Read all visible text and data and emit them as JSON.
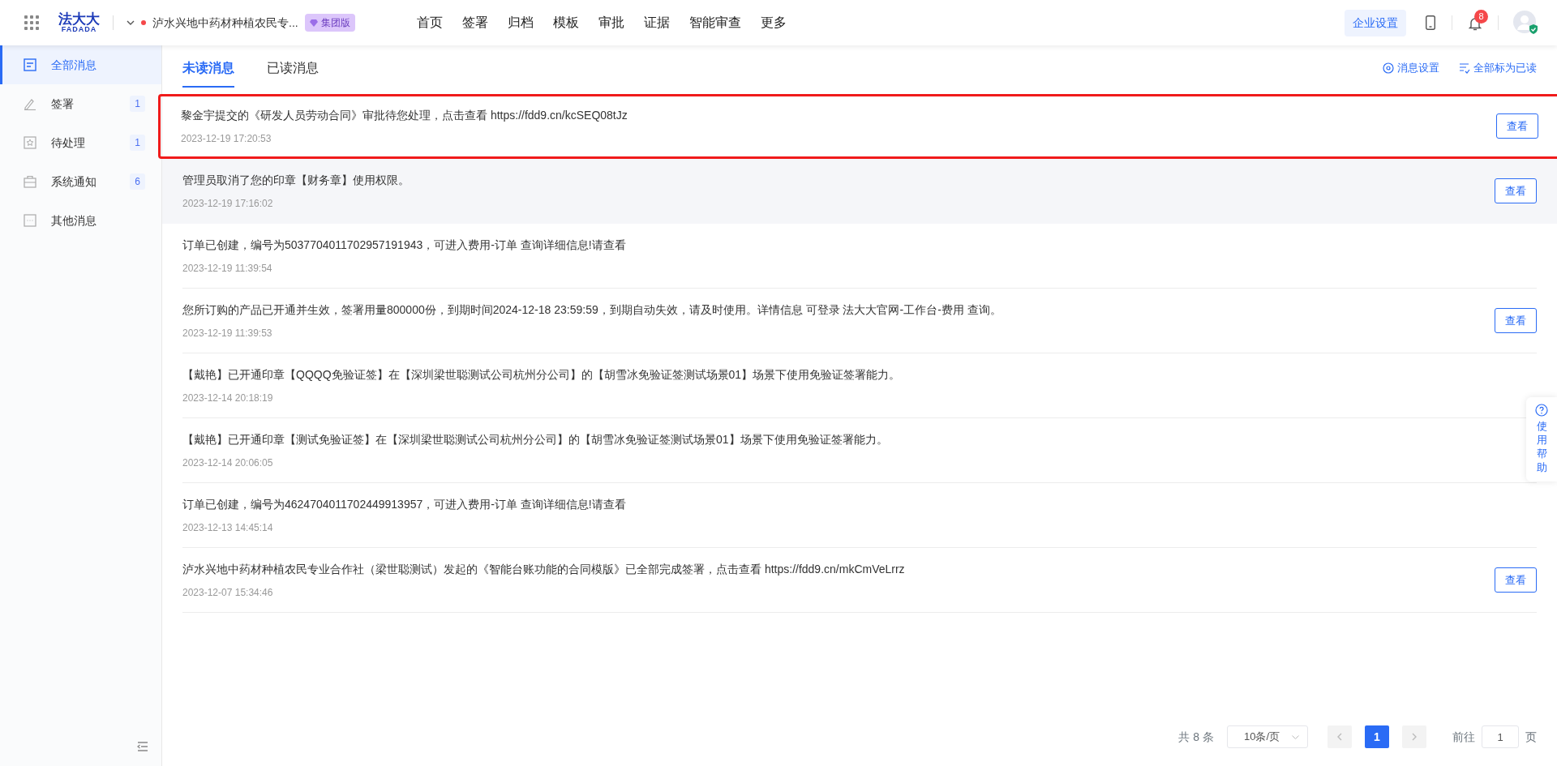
{
  "header": {
    "logo": {
      "cn": "法大大",
      "en": "FADADA"
    },
    "company": "泸水兴地中药材种植农民专...",
    "edition": "集团版",
    "nav": [
      {
        "label": "首页"
      },
      {
        "label": "签署"
      },
      {
        "label": "归档"
      },
      {
        "label": "模板"
      },
      {
        "label": "审批"
      },
      {
        "label": "证据"
      },
      {
        "label": "智能审查"
      },
      {
        "label": "更多"
      }
    ],
    "settings_button": "企业设置",
    "notification_count": "8"
  },
  "sidebar": {
    "items": [
      {
        "label": "全部消息",
        "selected": true
      },
      {
        "label": "签署",
        "count": "1",
        "selected": false
      },
      {
        "label": "待处理",
        "count": "1",
        "selected": false
      },
      {
        "label": "系统通知",
        "count": "6",
        "selected": false
      },
      {
        "label": "其他消息",
        "selected": false
      }
    ]
  },
  "tabs": [
    {
      "label": "未读消息",
      "selected": true
    },
    {
      "label": "已读消息",
      "selected": false
    }
  ],
  "actions": [
    "消息设置",
    "全部标为已读"
  ],
  "messages": [
    {
      "text": "黎金宇提交的《研发人员劳动合同》审批待您处理，点击查看 https://fdd9.cn/kcSEQ08tJz",
      "time": "2023-12-19 17:20:53",
      "action": "查看",
      "annotated": true,
      "hovered": false
    },
    {
      "text": "管理员取消了您的印章【财务章】使用权限。",
      "time": "2023-12-19 17:16:02",
      "action": "查看",
      "annotated": false,
      "hovered": true
    },
    {
      "text": "订单已创建，编号为5037704011702957191943，可进入费用-订单 查询详细信息!请查看",
      "time": "2023-12-19 11:39:54",
      "annotated": false,
      "hovered": false
    },
    {
      "text": "您所订购的产品已开通并生效，签署用量800000份，到期时间2024-12-18 23:59:59，到期自动失效，请及时使用。详情信息 可登录 法大大官网-工作台-费用 查询。",
      "time": "2023-12-19 11:39:53",
      "action": "查看",
      "annotated": false,
      "hovered": false
    },
    {
      "text": "【戴艳】已开通印章【QQQQ免验证签】在【深圳梁世聪测试公司杭州分公司】的【胡雪冰免验证签测试场景01】场景下使用免验证签署能力。",
      "time": "2023-12-14 20:18:19",
      "annotated": false,
      "hovered": false
    },
    {
      "text": "【戴艳】已开通印章【测试免验证签】在【深圳梁世聪测试公司杭州分公司】的【胡雪冰免验证签测试场景01】场景下使用免验证签署能力。",
      "time": "2023-12-14 20:06:05",
      "annotated": false,
      "hovered": false
    },
    {
      "text": "订单已创建，编号为4624704011702449913957，可进入费用-订单 查询详细信息!请查看",
      "time": "2023-12-13 14:45:14",
      "annotated": false,
      "hovered": false
    },
    {
      "text": "泸水兴地中药材种植农民专业合作社（梁世聪测试）发起的《智能台账功能的合同模版》已全部完成签署，点击查看 https://fdd9.cn/mkCmVeLrrz",
      "time": "2023-12-07 15:34:46",
      "action": "查看",
      "annotated": false,
      "hovered": false
    }
  ],
  "pagination": {
    "total": "共 8 条",
    "page_size": "10条/页",
    "pages": [
      {
        "label": "1",
        "selected": true
      }
    ],
    "goto_label": "前往",
    "goto_value": "1",
    "page_unit": "页"
  },
  "help": {
    "label": "使用帮助"
  }
}
